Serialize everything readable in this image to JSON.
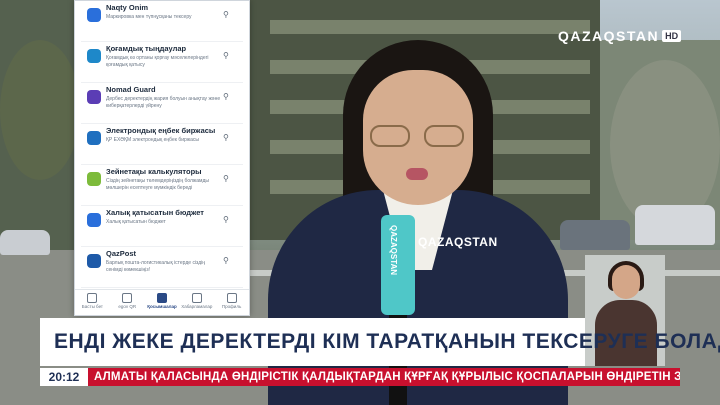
{
  "channel": {
    "logo_text": "QAZAQSTAN",
    "hd_badge": "HD"
  },
  "phone_app": {
    "items": [
      {
        "name": "Naqty Onim",
        "desc": "Маркировка мен түпнұсқаны тексеру",
        "icon": "qr-icon",
        "color": "#2a6fdb"
      },
      {
        "name": "Қоғамдық тыңдаулар",
        "desc": "Қоғамдық өз ортаны қорғау мәселелеріндегі қоғамдық қатысу",
        "icon": "plane-icon",
        "color": "#1e88c9"
      },
      {
        "name": "Nomad Guard",
        "desc": "Дербес деректердің жария болуын анықтау және киберқатерлерді үйрену",
        "icon": "shield-icon",
        "color": "#5b3db5"
      },
      {
        "name": "Электрондық еңбек биржасы",
        "desc": "ҚР ЕХӘҚМ электрондық еңбек биржасы",
        "icon": "e-icon",
        "color": "#1f6fbf"
      },
      {
        "name": "Зейнетақы калькуляторы",
        "desc": "Сіздің зейнетақы төлемдеріңіздің болжамды мөлшерін есептеуге мүмкіндік береді",
        "icon": "calculator-icon",
        "color": "#7dbb3b"
      },
      {
        "name": "Халық қатысатын бюджет",
        "desc": "Халық қатысатын бюджет",
        "icon": "budget-icon",
        "color": "#2a6fdb"
      },
      {
        "name": "QazPost",
        "desc": "Барлық пошта-логистикалық істерде сіздің сенімді көмекшіңіз!",
        "icon": "post-icon",
        "color": "#1e5aa8"
      }
    ],
    "pin_glyph": "⚲",
    "nav": [
      {
        "label": "Басты бет",
        "icon": "home-icon"
      },
      {
        "label": "egov QR",
        "icon": "qr-scan-icon"
      },
      {
        "label": "Қосымшалар",
        "icon": "apps-icon",
        "active": true
      },
      {
        "label": "Хабарламалар",
        "icon": "messages-icon"
      },
      {
        "label": "Профиль",
        "icon": "profile-icon"
      }
    ]
  },
  "coat_logo": "QAZAQSTAN",
  "mic_label": "QAZAQSTAN",
  "headline": "ЕНДІ ЖЕКЕ ДЕРЕКТЕРДІ КІМ ТАРАТҚАНЫН ТЕКСЕРУГЕ БОЛАДЫ",
  "ticker": {
    "time": "20:12",
    "text": "АЛМАТЫ ҚАЛАСЫНДА ӨНДІРІСТІК ҚАЛДЫҚТАРДАН ҚҰРҒАҚ ҚҰРЫЛЫС ҚОСПАЛАРЫН ӨНДІРЕТІН ЗАУЫТ ІСКЕ ҚОСЫЛДЫ"
  }
}
